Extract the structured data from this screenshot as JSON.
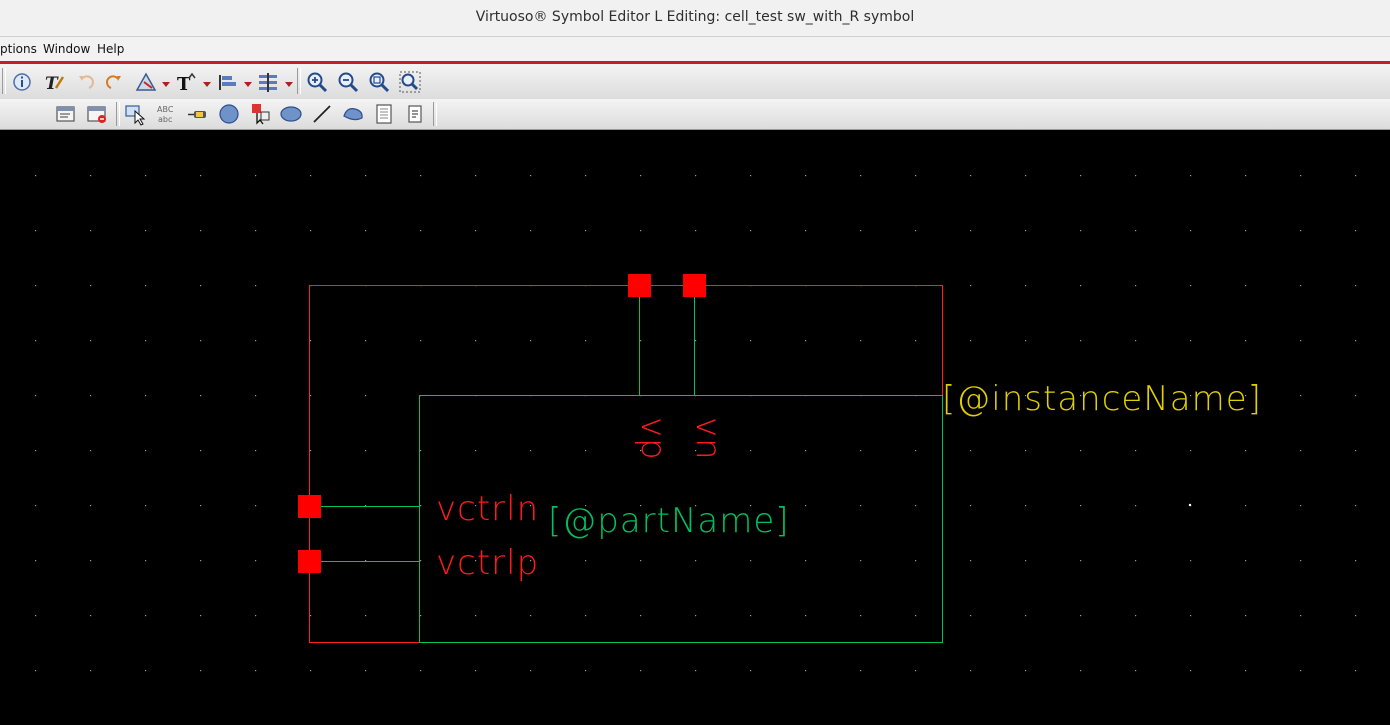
{
  "window": {
    "title": "Virtuoso® Symbol Editor L Editing: cell_test sw_with_R symbol"
  },
  "menubar": {
    "items": [
      "ptions",
      "Window",
      "Help"
    ]
  },
  "toolbar": {
    "row1_icons": [
      "info-icon",
      "edit-properties-icon",
      "undo-icon",
      "redo-icon",
      "select-filter-icon",
      "text-display-icon",
      "align-icon",
      "distribute-icon",
      "zoom-in-icon",
      "zoom-out-icon",
      "zoom-fit-icon",
      "zoom-area-icon"
    ],
    "row2_icons": [
      "save-icon",
      "save-close-icon",
      "select-icon",
      "label-icon",
      "pin-icon",
      "circle-icon",
      "shape-pin-icon",
      "ellipse-icon",
      "line-icon",
      "polygon-icon",
      "notepad-icon",
      "property-icon"
    ]
  },
  "colors": {
    "boundary": "#ff2020",
    "shape": "#00c060",
    "pin": "#ff0000",
    "pin_label": "#ff1a1a",
    "instance_label": "#e0d000",
    "part_label": "#00c060"
  },
  "canvas": {
    "pins": {
      "vp": "vp",
      "vn": "vn",
      "vctrln": "vctrln",
      "vctrlp": "vctrlp"
    },
    "instance_label": "[@instanceName]",
    "part_label": "[@partName]"
  }
}
